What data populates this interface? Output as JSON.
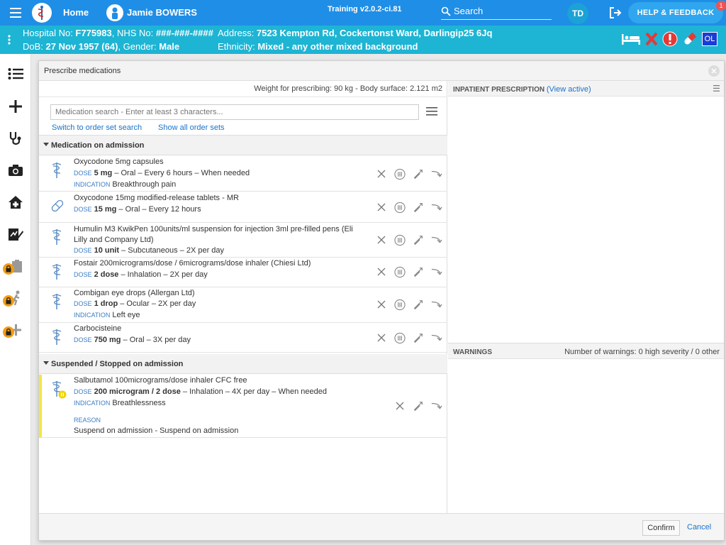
{
  "topbar": {
    "home_label": "Home",
    "patient_name": "Jamie BOWERS",
    "training_label": "Training v2.0.2-ci.81",
    "search_label": "Search",
    "user_initials": "TD",
    "help_label": "HELP & FEEDBACK",
    "help_badge": "1"
  },
  "banner": {
    "hospital_label": "Hospital No: ",
    "hospital_no": "F775983",
    "nhs_label": ", NHS No: ",
    "nhs_no": "###-###-####",
    "dob_label": "DoB: ",
    "dob": "27 Nov 1957 (64)",
    "gender_label": ", Gender: ",
    "gender": "Male",
    "address_label": "Address: ",
    "address": "7523 Kempton Rd, Cockertonst Ward, Darlingip25 6Jq",
    "ethnicity_label": "Ethnicity: ",
    "ethnicity": "Mixed - any other mixed background",
    "ol_badge": "OL"
  },
  "dialog": {
    "title": "Prescribe medications",
    "weight_line": "Weight for prescribing: 90 kg - Body surface: 2.121 m2",
    "search_placeholder": "Medication search - Enter at least 3 characters...",
    "switch_link": "Switch to order set search",
    "show_all_link": "Show all order sets",
    "section_admission": "Medication on admission",
    "section_suspended": "Suspended / Stopped on admission",
    "dose_tag": "DOSE",
    "indication_tag": "INDICATION",
    "reason_tag": "REASON",
    "medications": [
      {
        "name": "Oxycodone 5mg capsules",
        "dose": "5 mg",
        "route": " – Oral – Every 6 hours – When needed",
        "indication": "Breakthrough pain"
      },
      {
        "name": "Oxycodone 15mg modified-release tablets - MR",
        "dose": "15 mg",
        "route": " – Oral – Every 12 hours"
      },
      {
        "name": "Humulin M3 KwikPen 100units/ml suspension for injection 3ml pre-filled pens (Eli Lilly and Company Ltd)",
        "dose": "10 unit",
        "route": " – Subcutaneous – 2X per day"
      },
      {
        "name": "Fostair 200micrograms/dose / 6micrograms/dose inhaler (Chiesi Ltd)",
        "dose": "2 dose",
        "route": " – Inhalation – 2X per day"
      },
      {
        "name": "Combigan eye drops (Allergan Ltd)",
        "dose": "1 drop",
        "route": " – Ocular – 2X per day",
        "indication": "Left eye"
      },
      {
        "name": "Carbocisteine",
        "dose": "750 mg",
        "route": " – Oral – 3X per day"
      }
    ],
    "suspended_med": {
      "name": "Salbutamol 100micrograms/dose inhaler CFC free",
      "dose": "200 microgram / 2 dose",
      "route": " – Inhalation – 4X per day – When needed",
      "indication": "Breathlessness",
      "reason": "Suspend on admission - Suspend on admission"
    },
    "inpatient_title": "INPATIENT PRESCRIPTION",
    "view_active": "View active",
    "warnings_title": "WARNINGS",
    "warnings_count": "Number of warnings: 0 high severity / 0 other",
    "confirm_label": "Confirm",
    "cancel_label": "Cancel"
  }
}
